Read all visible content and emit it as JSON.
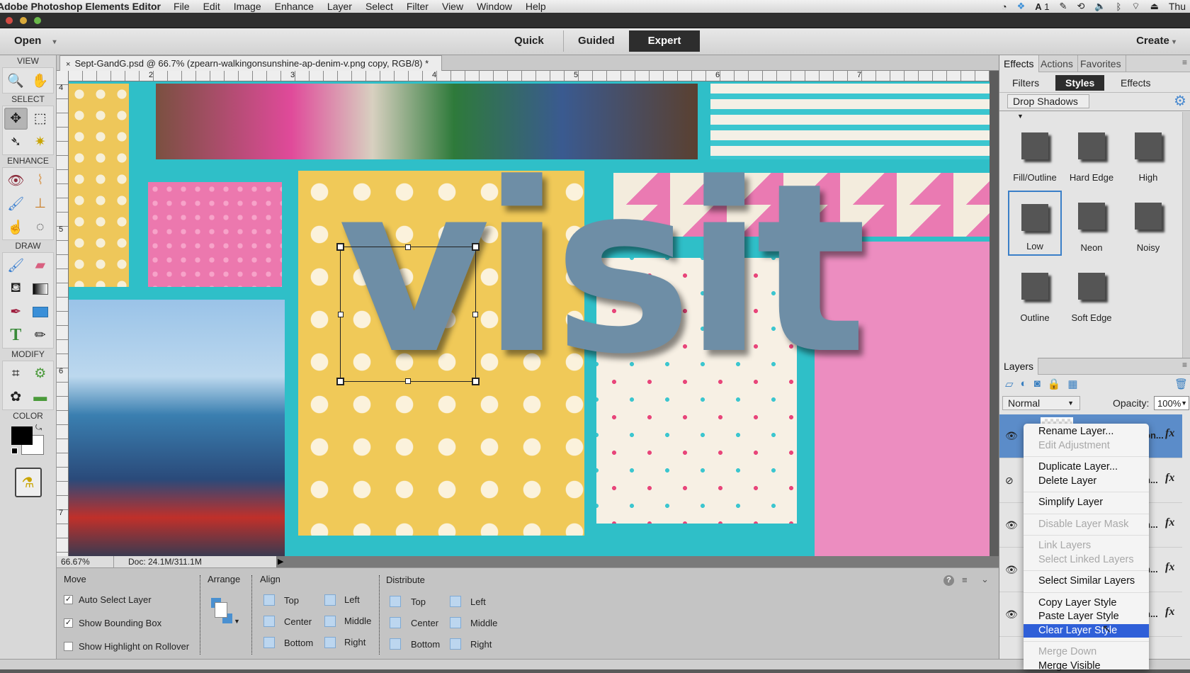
{
  "menubar": {
    "app": "Adobe Photoshop Elements Editor",
    "items": [
      "File",
      "Edit",
      "Image",
      "Enhance",
      "Layer",
      "Select",
      "Filter",
      "View",
      "Window",
      "Help"
    ],
    "status_icons": [
      "clock-icon",
      "dropbox-icon",
      "adobe-icon",
      "evernote-icon",
      "time-machine-icon",
      "volume-icon",
      "bluetooth-icon",
      "wifi-icon",
      "eject-icon"
    ],
    "adobe_count": "1",
    "clock": "Thu"
  },
  "modebar": {
    "open": "Open",
    "modes": [
      "Quick",
      "Guided",
      "Expert"
    ],
    "active_mode": "Expert",
    "create": "Create"
  },
  "toolbox": {
    "sections": [
      "VIEW",
      "SELECT",
      "ENHANCE",
      "DRAW",
      "MODIFY",
      "COLOR"
    ],
    "foreground": "#000000",
    "background": "#ffffff"
  },
  "document": {
    "tab": "Sept-GandG.psd @ 66.7% (zpearn-walkingonsunshine-ap-denim-v.png copy, RGB/8) *",
    "ruler_h": [
      "2",
      "3",
      "4",
      "5",
      "6",
      "7"
    ],
    "ruler_v": [
      "4",
      "5",
      "6",
      "7"
    ],
    "canvas_text": "visit",
    "zoom": "66.67%",
    "doc_size": "Doc: 24.1M/311.1M"
  },
  "options": {
    "move": "Move",
    "auto_select": {
      "label": "Auto Select Layer",
      "checked": true
    },
    "bounding_box": {
      "label": "Show Bounding Box",
      "checked": true
    },
    "highlight": {
      "label": "Show Highlight on Rollover",
      "checked": false
    },
    "arrange": "Arrange",
    "align": "Align",
    "align_items": [
      "Top",
      "Center",
      "Bottom",
      "Left",
      "Middle",
      "Right"
    ],
    "distribute": "Distribute",
    "distribute_items": [
      "Top",
      "Center",
      "Bottom",
      "Left",
      "Middle",
      "Right"
    ]
  },
  "panel": {
    "tabs": [
      "Effects",
      "Actions",
      "Favorites"
    ],
    "subtabs": [
      "Filters",
      "Styles",
      "Effects"
    ],
    "active_subtab": "Styles",
    "category": "Drop Shadows",
    "styles": [
      "Fill/Outline",
      "Hard Edge",
      "High",
      "Low",
      "Neon",
      "Noisy",
      "Outline",
      "Soft Edge"
    ],
    "selected_style": "Low"
  },
  "layers": {
    "title": "Layers",
    "blend": "Normal",
    "opacity_label": "Opacity:",
    "opacity": "100%",
    "rows": [
      {
        "name": "on...",
        "visible": true,
        "selected": true
      },
      {
        "name": "n...",
        "visible": false
      },
      {
        "name": "n...",
        "visible": true
      },
      {
        "name": "n...",
        "visible": true
      },
      {
        "name": "n...",
        "visible": true
      }
    ]
  },
  "context_menu": {
    "groups": [
      [
        {
          "label": "Rename Layer...",
          "enabled": true
        },
        {
          "label": "Edit Adjustment",
          "enabled": false
        }
      ],
      [
        {
          "label": "Duplicate Layer...",
          "enabled": true
        },
        {
          "label": "Delete Layer",
          "enabled": true
        }
      ],
      [
        {
          "label": "Simplify Layer",
          "enabled": true
        }
      ],
      [
        {
          "label": "Disable Layer Mask",
          "enabled": false
        }
      ],
      [
        {
          "label": "Link Layers",
          "enabled": false
        },
        {
          "label": "Select Linked Layers",
          "enabled": false
        }
      ],
      [
        {
          "label": "Select Similar Layers",
          "enabled": true
        }
      ],
      [
        {
          "label": "Copy Layer Style",
          "enabled": true
        },
        {
          "label": "Paste Layer Style",
          "enabled": true
        },
        {
          "label": "Clear Layer Style",
          "enabled": true,
          "highlighted": true
        }
      ],
      [
        {
          "label": "Merge Down",
          "enabled": false
        },
        {
          "label": "Merge Visible",
          "enabled": true
        }
      ]
    ]
  }
}
